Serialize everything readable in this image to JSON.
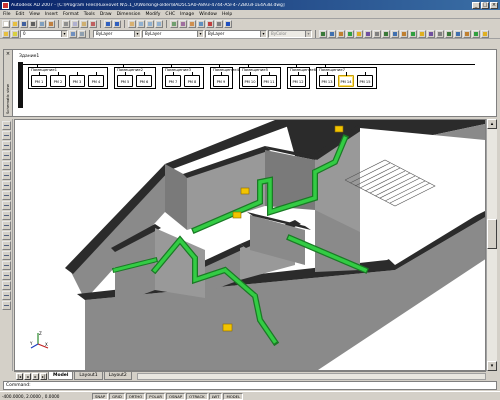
{
  "window": {
    "title": "Autodesk AD 2007 - [C:\\Program Files\\Ruхноvet N\\5.1_0\\WorkingFolder\\8AD5C5A0-A893-4744-A5F4-72B03F1E4A3B.dwg]"
  },
  "menu": [
    "File",
    "Edit",
    "View",
    "Insert",
    "Format",
    "Tools",
    "Draw",
    "Dimension",
    "Modify",
    "CHC",
    "Image",
    "Window",
    "Help"
  ],
  "toolbar": {
    "layer_value": "0",
    "color_value": "ByLayer",
    "linetype_value": "ByLayer",
    "lineweight_value": "ByLayer",
    "plotstyle_value": "ByColor"
  },
  "schema_panel": {
    "sidebar_label": "Schematic view",
    "building_label": "Здание1",
    "rooms": [
      {
        "label": "Помещение1",
        "modules": [
          "PM 1",
          "PM 2",
          "PM 3",
          "PM 4"
        ]
      },
      {
        "label": "Помещение2",
        "modules": [
          "PM 5",
          "PM 6"
        ]
      },
      {
        "label": "Помещение3",
        "modules": [
          "PM 7",
          "PM 8"
        ]
      },
      {
        "label": "Помещение4",
        "modules": [
          "PM 9"
        ]
      },
      {
        "label": "Помещение5",
        "modules": [
          "PM 10",
          "PM 11"
        ]
      },
      {
        "label": "Помещение6",
        "modules": [
          "PM 12"
        ]
      },
      {
        "label": "Помещение7",
        "modules": [
          "PM 13",
          "PM 14",
          "PM 15"
        ]
      }
    ]
  },
  "viewport": {
    "wall_color": "#8a8a8a",
    "wall_top_color": "#2b2b2b",
    "floor_color": "#ffffff",
    "cable_color": "#22aa33",
    "device_color": "#f2c400"
  },
  "tabs": [
    "Model",
    "Layout1",
    "Layout2"
  ],
  "command_line": "Command:",
  "status": {
    "coords": "-400.0000, 2.0000 , 0.0000",
    "buttons": [
      "SNAP",
      "GRID",
      "ORTHO",
      "POLAR",
      "OSNAP",
      "OTRACK",
      "LWT",
      "MODEL"
    ]
  },
  "icons": {
    "app": "autocad-app-icon",
    "close": "close-icon",
    "minimize": "minimize-icon",
    "maximize": "maximize-icon",
    "ucs": "ucs-axis-icon"
  }
}
